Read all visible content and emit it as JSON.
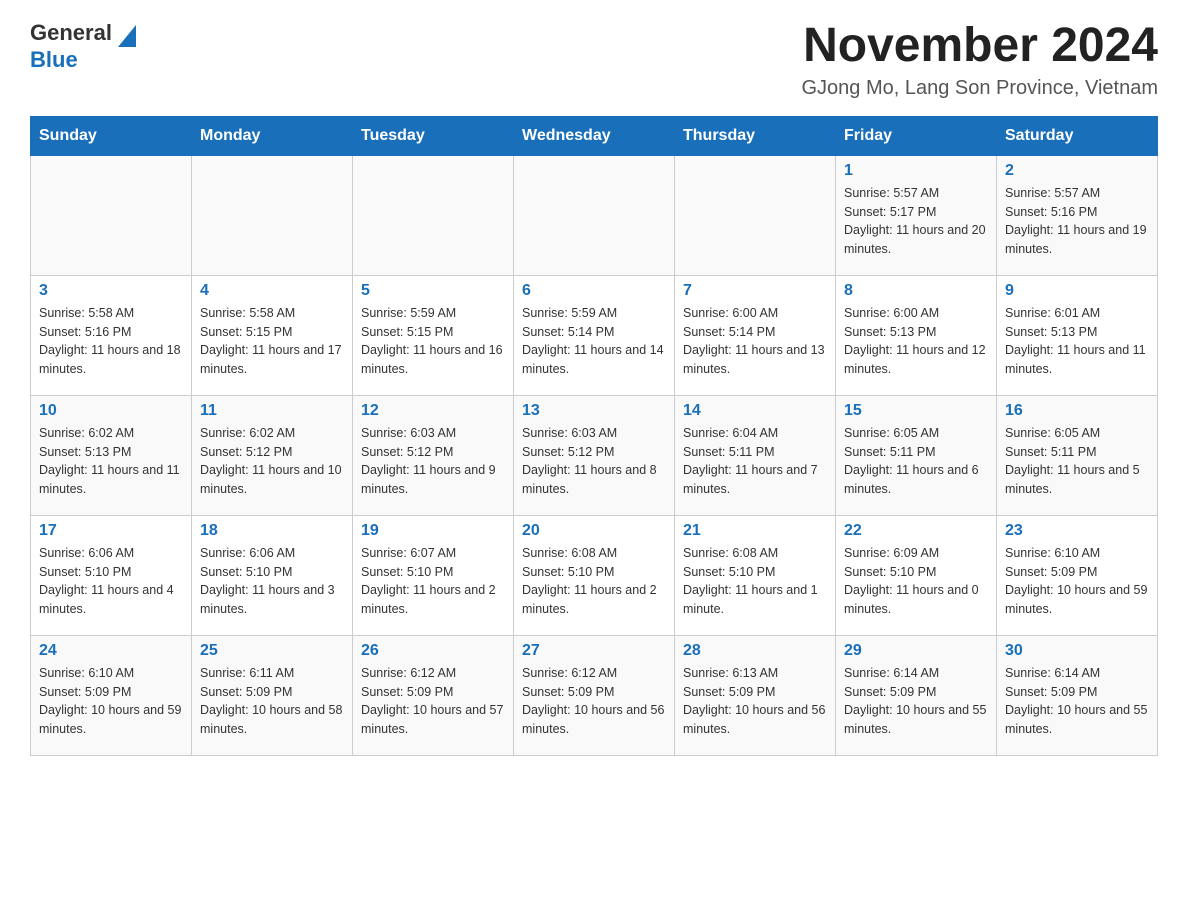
{
  "header": {
    "logo_general": "General",
    "logo_blue": "Blue",
    "month_title": "November 2024",
    "location": "GJong Mo, Lang Son Province, Vietnam"
  },
  "weekdays": [
    "Sunday",
    "Monday",
    "Tuesday",
    "Wednesday",
    "Thursday",
    "Friday",
    "Saturday"
  ],
  "weeks": [
    [
      {
        "day": "",
        "info": ""
      },
      {
        "day": "",
        "info": ""
      },
      {
        "day": "",
        "info": ""
      },
      {
        "day": "",
        "info": ""
      },
      {
        "day": "",
        "info": ""
      },
      {
        "day": "1",
        "info": "Sunrise: 5:57 AM\nSunset: 5:17 PM\nDaylight: 11 hours and 20 minutes."
      },
      {
        "day": "2",
        "info": "Sunrise: 5:57 AM\nSunset: 5:16 PM\nDaylight: 11 hours and 19 minutes."
      }
    ],
    [
      {
        "day": "3",
        "info": "Sunrise: 5:58 AM\nSunset: 5:16 PM\nDaylight: 11 hours and 18 minutes."
      },
      {
        "day": "4",
        "info": "Sunrise: 5:58 AM\nSunset: 5:15 PM\nDaylight: 11 hours and 17 minutes."
      },
      {
        "day": "5",
        "info": "Sunrise: 5:59 AM\nSunset: 5:15 PM\nDaylight: 11 hours and 16 minutes."
      },
      {
        "day": "6",
        "info": "Sunrise: 5:59 AM\nSunset: 5:14 PM\nDaylight: 11 hours and 14 minutes."
      },
      {
        "day": "7",
        "info": "Sunrise: 6:00 AM\nSunset: 5:14 PM\nDaylight: 11 hours and 13 minutes."
      },
      {
        "day": "8",
        "info": "Sunrise: 6:00 AM\nSunset: 5:13 PM\nDaylight: 11 hours and 12 minutes."
      },
      {
        "day": "9",
        "info": "Sunrise: 6:01 AM\nSunset: 5:13 PM\nDaylight: 11 hours and 11 minutes."
      }
    ],
    [
      {
        "day": "10",
        "info": "Sunrise: 6:02 AM\nSunset: 5:13 PM\nDaylight: 11 hours and 11 minutes."
      },
      {
        "day": "11",
        "info": "Sunrise: 6:02 AM\nSunset: 5:12 PM\nDaylight: 11 hours and 10 minutes."
      },
      {
        "day": "12",
        "info": "Sunrise: 6:03 AM\nSunset: 5:12 PM\nDaylight: 11 hours and 9 minutes."
      },
      {
        "day": "13",
        "info": "Sunrise: 6:03 AM\nSunset: 5:12 PM\nDaylight: 11 hours and 8 minutes."
      },
      {
        "day": "14",
        "info": "Sunrise: 6:04 AM\nSunset: 5:11 PM\nDaylight: 11 hours and 7 minutes."
      },
      {
        "day": "15",
        "info": "Sunrise: 6:05 AM\nSunset: 5:11 PM\nDaylight: 11 hours and 6 minutes."
      },
      {
        "day": "16",
        "info": "Sunrise: 6:05 AM\nSunset: 5:11 PM\nDaylight: 11 hours and 5 minutes."
      }
    ],
    [
      {
        "day": "17",
        "info": "Sunrise: 6:06 AM\nSunset: 5:10 PM\nDaylight: 11 hours and 4 minutes."
      },
      {
        "day": "18",
        "info": "Sunrise: 6:06 AM\nSunset: 5:10 PM\nDaylight: 11 hours and 3 minutes."
      },
      {
        "day": "19",
        "info": "Sunrise: 6:07 AM\nSunset: 5:10 PM\nDaylight: 11 hours and 2 minutes."
      },
      {
        "day": "20",
        "info": "Sunrise: 6:08 AM\nSunset: 5:10 PM\nDaylight: 11 hours and 2 minutes."
      },
      {
        "day": "21",
        "info": "Sunrise: 6:08 AM\nSunset: 5:10 PM\nDaylight: 11 hours and 1 minute."
      },
      {
        "day": "22",
        "info": "Sunrise: 6:09 AM\nSunset: 5:10 PM\nDaylight: 11 hours and 0 minutes."
      },
      {
        "day": "23",
        "info": "Sunrise: 6:10 AM\nSunset: 5:09 PM\nDaylight: 10 hours and 59 minutes."
      }
    ],
    [
      {
        "day": "24",
        "info": "Sunrise: 6:10 AM\nSunset: 5:09 PM\nDaylight: 10 hours and 59 minutes."
      },
      {
        "day": "25",
        "info": "Sunrise: 6:11 AM\nSunset: 5:09 PM\nDaylight: 10 hours and 58 minutes."
      },
      {
        "day": "26",
        "info": "Sunrise: 6:12 AM\nSunset: 5:09 PM\nDaylight: 10 hours and 57 minutes."
      },
      {
        "day": "27",
        "info": "Sunrise: 6:12 AM\nSunset: 5:09 PM\nDaylight: 10 hours and 56 minutes."
      },
      {
        "day": "28",
        "info": "Sunrise: 6:13 AM\nSunset: 5:09 PM\nDaylight: 10 hours and 56 minutes."
      },
      {
        "day": "29",
        "info": "Sunrise: 6:14 AM\nSunset: 5:09 PM\nDaylight: 10 hours and 55 minutes."
      },
      {
        "day": "30",
        "info": "Sunrise: 6:14 AM\nSunset: 5:09 PM\nDaylight: 10 hours and 55 minutes."
      }
    ]
  ]
}
